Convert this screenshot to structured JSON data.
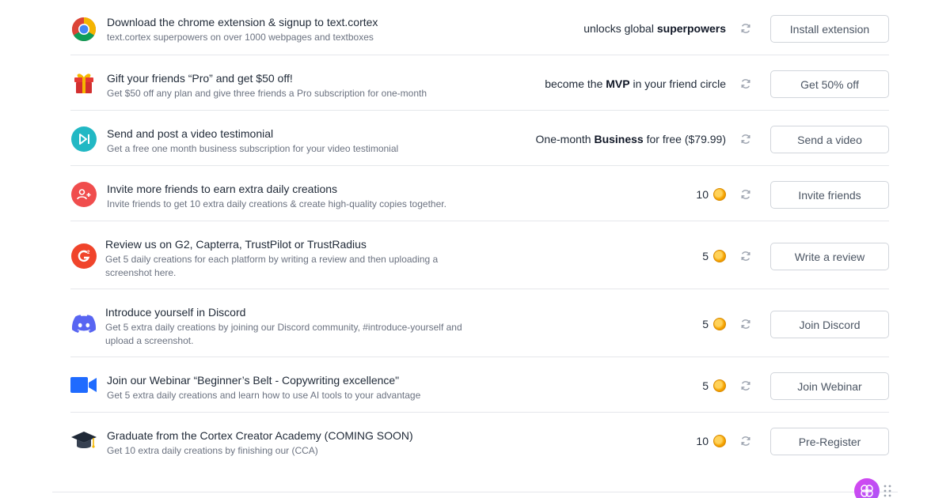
{
  "tasks": [
    {
      "title": "Download the chrome extension & signup to text.cortex",
      "subtitle": "text.cortex superpowers on over 1000 webpages and textboxes",
      "reward_pre": "unlocks global ",
      "reward_bold": "superpowers",
      "reward_post": "",
      "button": "Install extension",
      "icon": "chrome-icon"
    },
    {
      "title": "Gift your friends “Pro” and get $50 off!",
      "subtitle": "Get $50 off any plan and give three friends a Pro subscription for one-month",
      "reward_pre": "become the ",
      "reward_bold": "MVP",
      "reward_post": " in your friend circle",
      "button": "Get 50% off",
      "icon": "gift-icon"
    },
    {
      "title": "Send and post a video testimonial",
      "subtitle": "Get a free one month business subscription for your video testimonial",
      "reward_pre": "One-month ",
      "reward_bold": "Business",
      "reward_post": " for free ($79.99)",
      "button": "Send a video",
      "icon": "video-play-icon"
    },
    {
      "title": "Invite more friends to earn extra daily creations",
      "subtitle": "Invite friends to get 10 extra daily creations & create high-quality copies together.",
      "reward_value": "10",
      "button": "Invite friends",
      "icon": "add-user-icon"
    },
    {
      "title": "Review us on G2, Capterra, TrustPilot or TrustRadius",
      "subtitle": "Get 5 daily creations for each platform by writing a review and then uploading a screenshot here.",
      "reward_value": "5",
      "button": "Write a review",
      "icon": "g2-icon"
    },
    {
      "title": "Introduce yourself in Discord",
      "subtitle": "Get 5 extra daily creations by joining our Discord community, #introduce-yourself and upload a screenshot.",
      "reward_value": "5",
      "button": "Join Discord",
      "icon": "discord-icon"
    },
    {
      "title": "Join our Webinar “Beginner’s Belt - Copywriting excellence\"",
      "subtitle": "Get 5 extra daily creations and learn how to use AI tools to your advantage",
      "reward_value": "5",
      "button": "Join Webinar",
      "icon": "zoom-camera-icon"
    },
    {
      "title": "Graduate from the Cortex Creator Academy (COMING SOON)",
      "subtitle": "Get 10 extra daily creations by finishing our (CCA)",
      "reward_value": "10",
      "button": "Pre-Register",
      "icon": "graduation-cap-icon"
    }
  ],
  "colors": {
    "accent_red": "#f04d4d",
    "teal": "#22b8c4",
    "discord": "#5865f2",
    "zoom": "#1f6bff",
    "coin": "#f5a300"
  }
}
